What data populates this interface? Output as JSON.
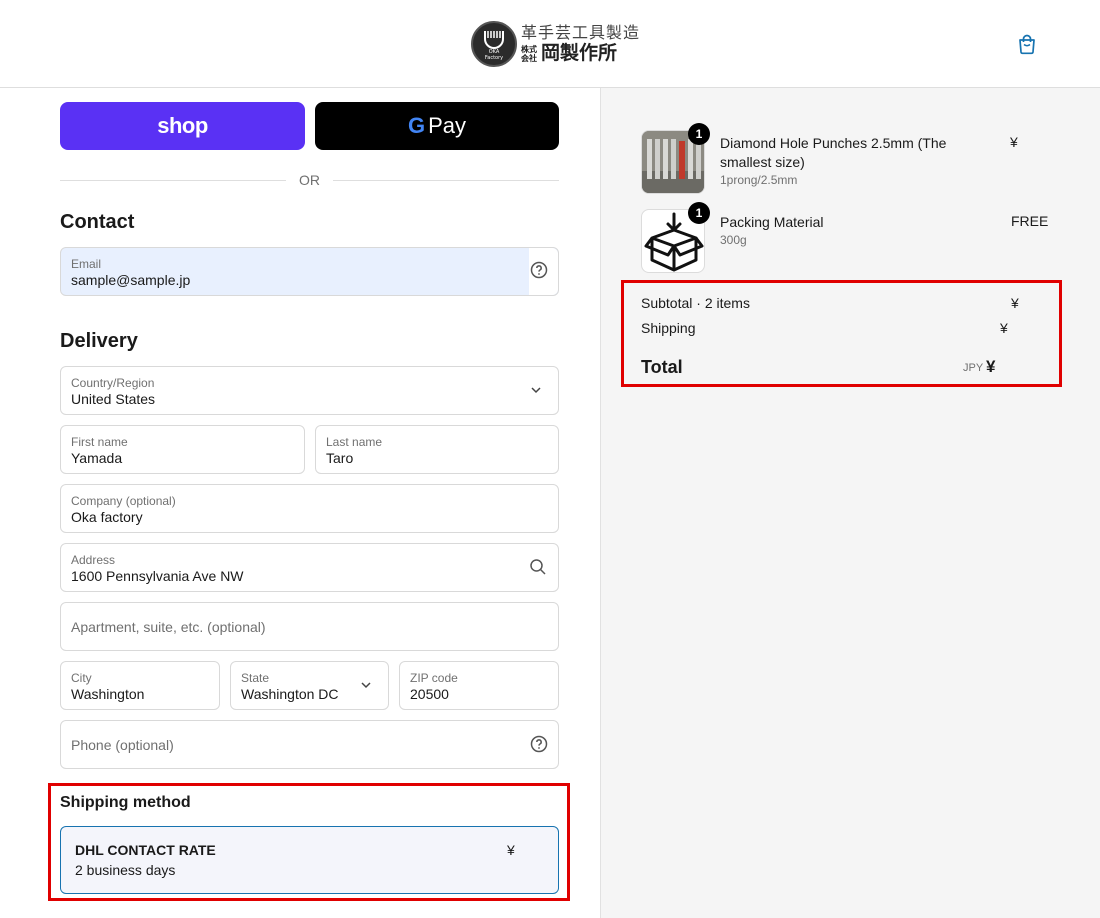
{
  "header": {
    "logo_line1": "革手芸工具製造",
    "logo_small_top": "株式",
    "logo_small_bottom": "会社",
    "logo_name": "岡製作所",
    "logo_mark_text_top": "OKA",
    "logo_mark_text_bottom": "Factory",
    "cart_icon": "shopping-bag-icon"
  },
  "express": {
    "shop_label": "shop",
    "gpay_g": "G",
    "gpay_label": "Pay",
    "divider": "OR"
  },
  "contact": {
    "title": "Contact",
    "email_label": "Email",
    "email_value": "sample@sample.jp",
    "help_icon": "help-circle-icon"
  },
  "delivery": {
    "title": "Delivery",
    "country_label": "Country/Region",
    "country_value": "United States",
    "first_name_label": "First name",
    "first_name_value": "Yamada",
    "last_name_label": "Last name",
    "last_name_value": "Taro",
    "company_label": "Company (optional)",
    "company_value": "Oka factory",
    "address_label": "Address",
    "address_value": "1600 Pennsylvania Ave NW",
    "apartment_placeholder": "Apartment, suite, etc. (optional)",
    "city_label": "City",
    "city_value": "Washington",
    "state_label": "State",
    "state_value": "Washington DC",
    "zip_label": "ZIP code",
    "zip_value": "20500",
    "phone_placeholder": "Phone (optional)"
  },
  "shipping": {
    "title": "Shipping method",
    "option_name": "DHL CONTACT RATE",
    "option_days": "2 business days",
    "option_price": "¥"
  },
  "cart": {
    "items": [
      {
        "title": "Diamond Hole Punches 2.5mm (The smallest size)",
        "variant": "1prong/2.5mm",
        "quantity": "1",
        "price": "¥"
      },
      {
        "title": "Packing Material",
        "variant": "300g",
        "quantity": "1",
        "price": "FREE"
      }
    ]
  },
  "summary": {
    "subtotal_label": "Subtotal · 2 items",
    "subtotal_value": "¥",
    "shipping_label": "Shipping",
    "shipping_value": "¥",
    "total_label": "Total",
    "currency": "JPY",
    "total_value": "¥"
  },
  "colors": {
    "shop_pay": "#5a31f4",
    "gpay": "#000000",
    "autofill": "#e8f0fe",
    "selected_border": "#1773b0",
    "highlight": "#e00000"
  }
}
